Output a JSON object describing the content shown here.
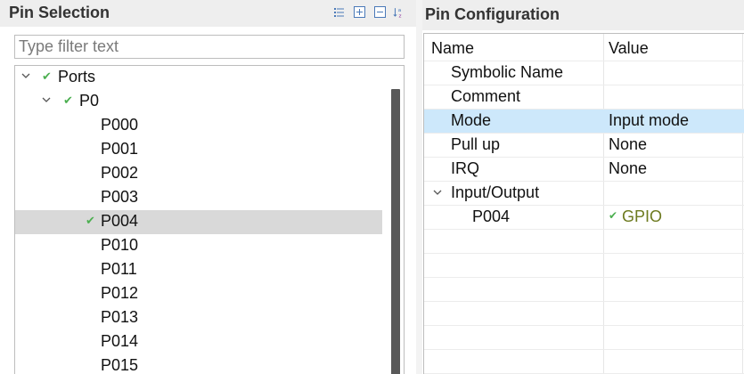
{
  "pin_selection": {
    "title": "Pin Selection",
    "toolbar": [
      "collapse-list-icon",
      "expand-all-icon",
      "collapse-all-icon",
      "sort-az-icon"
    ],
    "filter_placeholder": "Type filter text",
    "tree": {
      "root": {
        "label": "Ports",
        "checked": true,
        "expanded": true
      },
      "group": {
        "label": "P0",
        "checked": true,
        "expanded": true
      },
      "pins": [
        {
          "label": "P000",
          "checked": false,
          "selected": false
        },
        {
          "label": "P001",
          "checked": false,
          "selected": false
        },
        {
          "label": "P002",
          "checked": false,
          "selected": false
        },
        {
          "label": "P003",
          "checked": false,
          "selected": false
        },
        {
          "label": "P004",
          "checked": true,
          "selected": true
        },
        {
          "label": "P010",
          "checked": false,
          "selected": false
        },
        {
          "label": "P011",
          "checked": false,
          "selected": false
        },
        {
          "label": "P012",
          "checked": false,
          "selected": false
        },
        {
          "label": "P013",
          "checked": false,
          "selected": false
        },
        {
          "label": "P014",
          "checked": false,
          "selected": false
        },
        {
          "label": "P015",
          "checked": false,
          "selected": false
        }
      ]
    }
  },
  "pin_configuration": {
    "title": "Pin Configuration",
    "columns": {
      "name": "Name",
      "value": "Value"
    },
    "rows": [
      {
        "name": "Symbolic Name",
        "value": ""
      },
      {
        "name": "Comment",
        "value": ""
      },
      {
        "name": "Mode",
        "value": "Input mode",
        "selected": true
      },
      {
        "name": "Pull up",
        "value": "None"
      },
      {
        "name": "IRQ",
        "value": "None"
      }
    ],
    "group": {
      "name": "Input/Output",
      "expanded": true,
      "child": {
        "name": "P004",
        "value": "GPIO",
        "checked": true
      }
    }
  },
  "colors": {
    "check": "#4caf50",
    "selected_tree_row": "#d9d9d9",
    "selected_table_row": "#cde8fb",
    "gpio_text": "#6d7a1f"
  }
}
